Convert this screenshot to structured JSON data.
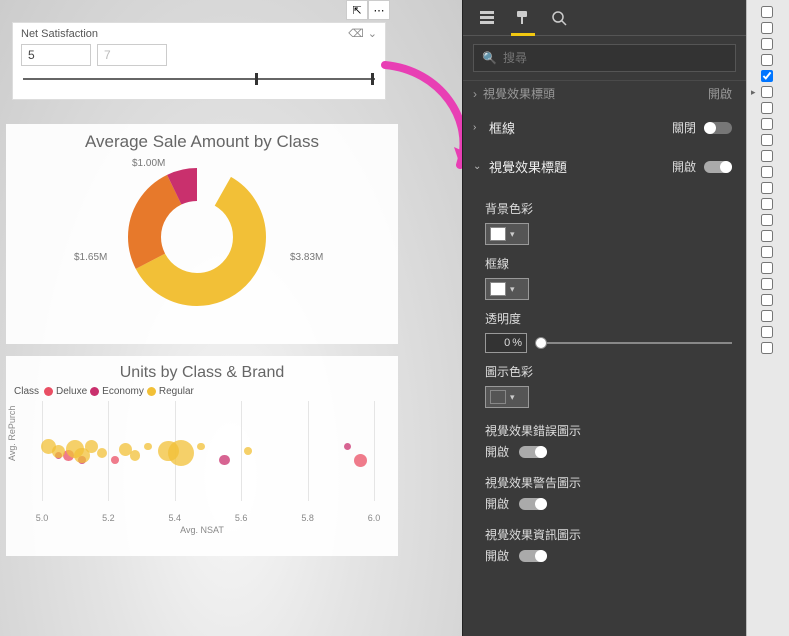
{
  "canvas": {
    "header_icons": {
      "popout": "⇱",
      "more": "⋯"
    },
    "slicer": {
      "title": "Net Satisfaction",
      "from": "5",
      "to": "7",
      "clear_icon": "⌫",
      "chevron": "⌄"
    },
    "donut": {
      "title": "Average Sale Amount by Class",
      "labels": {
        "a": "$1.00M",
        "b": "$1.65M",
        "c": "$3.83M"
      }
    },
    "scatter": {
      "title": "Units by Class & Brand",
      "legend_head": "Class",
      "legend": [
        {
          "name": "Deluxe",
          "color": "#e94f64"
        },
        {
          "name": "Economy",
          "color": "#c9306d"
        },
        {
          "name": "Regular",
          "color": "#f2c037"
        }
      ],
      "y_label": "Avg. RePurch",
      "x_label": "Avg. NSAT",
      "x_ticks": [
        "5.0",
        "5.2",
        "5.4",
        "5.6",
        "5.8",
        "6.0"
      ]
    }
  },
  "chart_data": [
    {
      "type": "pie",
      "title": "Average Sale Amount by Class",
      "series": [
        {
          "name": "Deluxe",
          "value": 1.0,
          "color": "#c9306d"
        },
        {
          "name": "Economy",
          "value": 1.65,
          "color": "#e7792b"
        },
        {
          "name": "Regular",
          "value": 3.83,
          "color": "#f2c037"
        }
      ],
      "unit": "$M"
    },
    {
      "type": "scatter",
      "title": "Units by Class & Brand",
      "xlabel": "Avg. NSAT",
      "ylabel": "Avg. RePurch",
      "xlim": [
        5.0,
        6.0
      ],
      "series": [
        {
          "name": "Deluxe",
          "color": "#e94f64",
          "points": [
            [
              5.08,
              0.45,
              4
            ],
            [
              5.22,
              0.4,
              3
            ],
            [
              5.96,
              0.4,
              5
            ]
          ]
        },
        {
          "name": "Economy",
          "color": "#c9306d",
          "points": [
            [
              5.05,
              0.45,
              3
            ],
            [
              5.12,
              0.4,
              3
            ],
            [
              5.55,
              0.4,
              4
            ],
            [
              5.92,
              0.55,
              3
            ]
          ]
        },
        {
          "name": "Regular",
          "color": "#f2c037",
          "points": [
            [
              5.02,
              0.55,
              6
            ],
            [
              5.05,
              0.5,
              5
            ],
            [
              5.1,
              0.52,
              7
            ],
            [
              5.12,
              0.45,
              6
            ],
            [
              5.15,
              0.55,
              5
            ],
            [
              5.18,
              0.48,
              4
            ],
            [
              5.25,
              0.52,
              5
            ],
            [
              5.28,
              0.45,
              4
            ],
            [
              5.32,
              0.55,
              3
            ],
            [
              5.38,
              0.5,
              8
            ],
            [
              5.42,
              0.48,
              10
            ],
            [
              5.48,
              0.55,
              3
            ],
            [
              5.62,
              0.5,
              3
            ]
          ]
        }
      ]
    }
  ],
  "format_pane": {
    "search_placeholder": "搜尋",
    "cutoff_section": {
      "title": "視覺效果標頭",
      "state": "開啟"
    },
    "sections": [
      {
        "key": "border",
        "title": "框線",
        "state": "關閉",
        "expanded": false,
        "on": false
      },
      {
        "key": "vh",
        "title": "視覺效果標題",
        "state": "開啟",
        "expanded": true,
        "on": true
      }
    ],
    "vh_props": {
      "bg_color_label": "背景色彩",
      "bg_color": "#ffffff",
      "border_label": "框線",
      "border_color": "#ffffff",
      "opacity_label": "透明度",
      "opacity_value": "0",
      "opacity_unit": "%",
      "icon_color_label": "圖示色彩",
      "icon_color": "#555555",
      "toggles": [
        {
          "label": "視覺效果錯誤圖示",
          "state": "開啟"
        },
        {
          "label": "視覺效果警告圖示",
          "state": "開啟"
        },
        {
          "label": "視覺效果資訊圖示",
          "state": "開啟"
        }
      ]
    }
  },
  "side_strip": {
    "rows": [
      {
        "checked": false
      },
      {
        "checked": false
      },
      {
        "checked": false
      },
      {
        "checked": false
      },
      {
        "checked": true
      },
      {
        "checked": false,
        "expander": true
      },
      {
        "checked": false
      },
      {
        "checked": false
      },
      {
        "checked": false
      },
      {
        "checked": false
      },
      {
        "checked": false
      },
      {
        "checked": false
      },
      {
        "checked": false
      },
      {
        "checked": false
      },
      {
        "checked": false
      },
      {
        "checked": false
      },
      {
        "checked": false
      },
      {
        "checked": false
      },
      {
        "checked": false
      },
      {
        "checked": false
      },
      {
        "checked": false
      },
      {
        "checked": false
      }
    ]
  }
}
